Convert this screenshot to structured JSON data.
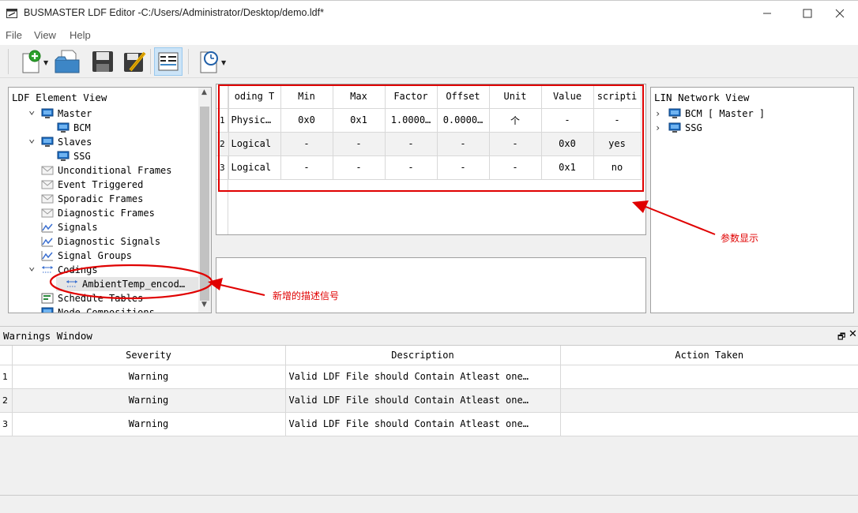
{
  "window": {
    "title": "BUSMASTER LDF Editor -C:/Users/Administrator/Desktop/demo.ldf*"
  },
  "menu": [
    "File",
    "View",
    "Help"
  ],
  "toolbar": {
    "icons": [
      "new-file-icon",
      "open-folder-icon",
      "save-icon",
      "edit-icon",
      "table-view-icon",
      "clock-icon"
    ]
  },
  "element_view": {
    "title": "LDF Element View",
    "items": [
      {
        "label": "Master",
        "icon": "monitor-icon",
        "level": 0,
        "expanded": true
      },
      {
        "label": "BCM",
        "icon": "monitor-icon",
        "level": 1
      },
      {
        "label": "Slaves",
        "icon": "monitor-icon",
        "level": 0,
        "expanded": true
      },
      {
        "label": "SSG",
        "icon": "monitor-icon",
        "level": 1
      },
      {
        "label": "Unconditional Frames",
        "icon": "frame-icon",
        "level": 0
      },
      {
        "label": "Event Triggered",
        "icon": "frame-icon",
        "level": 0
      },
      {
        "label": "Sporadic Frames",
        "icon": "frame-icon",
        "level": 0
      },
      {
        "label": "Diagnostic Frames",
        "icon": "frame-icon",
        "level": 0
      },
      {
        "label": "Signals",
        "icon": "signal-icon",
        "level": 0
      },
      {
        "label": "Diagnostic Signals",
        "icon": "signal-icon",
        "level": 0
      },
      {
        "label": "Signal Groups",
        "icon": "signal-icon",
        "level": 0
      },
      {
        "label": "Codings",
        "icon": "coding-icon",
        "level": 0,
        "expanded": true
      },
      {
        "label": "AmbientTemp_encod…",
        "icon": "coding-icon",
        "level": 1,
        "selected": true
      },
      {
        "label": "Schedule Tables",
        "icon": "schedule-icon",
        "level": 0
      },
      {
        "label": "Node Compositions",
        "icon": "monitor-icon",
        "level": 0
      }
    ]
  },
  "coding_table": {
    "headers": [
      "oding T",
      "Min",
      "Max",
      "Factor",
      "Offset",
      "Unit",
      "Value",
      "scripti"
    ],
    "rows": [
      {
        "num": "1",
        "cells": [
          "Physic…",
          "0x0",
          "0x1",
          "1.0000…",
          "0.0000…",
          "个",
          "-",
          "-"
        ]
      },
      {
        "num": "2",
        "cells": [
          "Logical",
          "-",
          "-",
          "-",
          "-",
          "-",
          "0x0",
          "yes"
        ]
      },
      {
        "num": "3",
        "cells": [
          "Logical",
          "-",
          "-",
          "-",
          "-",
          "-",
          "0x1",
          "no"
        ]
      }
    ]
  },
  "network_view": {
    "title": "LIN Network View",
    "items": [
      "BCM [ Master ]",
      "SSG"
    ]
  },
  "warnings": {
    "title": "Warnings Window",
    "headers": [
      "Severity",
      "Description",
      "Action Taken"
    ],
    "rows": [
      {
        "num": "1",
        "severity": "Warning",
        "description": "Valid LDF File should Contain Atleast one…",
        "action": ""
      },
      {
        "num": "2",
        "severity": "Warning",
        "description": "Valid LDF File should Contain Atleast one…",
        "action": ""
      },
      {
        "num": "3",
        "severity": "Warning",
        "description": "Valid LDF File should Contain Atleast one…",
        "action": ""
      }
    ]
  },
  "annotations": {
    "params": "参数显示",
    "new_signal": "新增的描述信号"
  },
  "colors": {
    "annotation": "#e00000",
    "selected_row": "#e5e5e5",
    "toolbar_active": "#cce4f7"
  }
}
